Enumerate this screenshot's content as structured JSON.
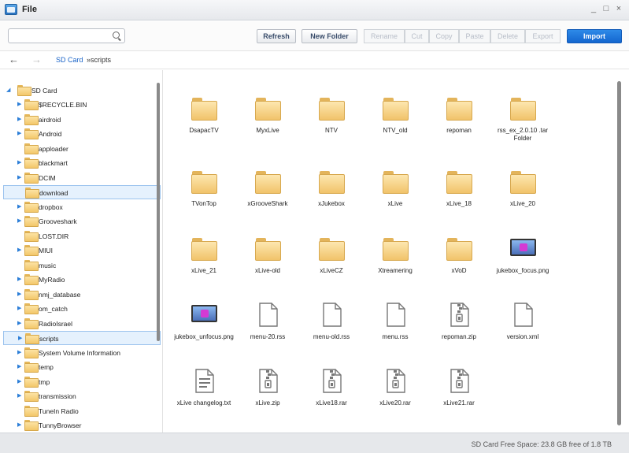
{
  "window": {
    "title": "File",
    "minimize": "_",
    "maximize": "□",
    "close": "×"
  },
  "search": {
    "value": "",
    "placeholder": ""
  },
  "toolbar": {
    "refresh": "Refresh",
    "new_folder": "New Folder",
    "rename": "Rename",
    "cut": "Cut",
    "copy": "Copy",
    "paste": "Paste",
    "delete": "Delete",
    "export": "Export",
    "import": "Import"
  },
  "nav": {
    "back": "←",
    "forward": "→",
    "crumb_root": "SD Card",
    "crumb_current": "»scripts"
  },
  "tree": {
    "root": "SD Card",
    "items": [
      {
        "label": "$RECYCLE.BIN",
        "expandable": true
      },
      {
        "label": "airdroid",
        "expandable": true
      },
      {
        "label": "Android",
        "expandable": true
      },
      {
        "label": "apploader",
        "expandable": false
      },
      {
        "label": "blackmart",
        "expandable": true
      },
      {
        "label": "DCIM",
        "expandable": true
      },
      {
        "label": "download",
        "expandable": false
      },
      {
        "label": "dropbox",
        "expandable": true
      },
      {
        "label": "Grooveshark",
        "expandable": true
      },
      {
        "label": "LOST.DIR",
        "expandable": false
      },
      {
        "label": "MIUI",
        "expandable": true
      },
      {
        "label": "music",
        "expandable": false
      },
      {
        "label": "MyRadio",
        "expandable": true
      },
      {
        "label": "nmj_database",
        "expandable": true
      },
      {
        "label": "om_catch",
        "expandable": true
      },
      {
        "label": "RadioIsrael",
        "expandable": true
      },
      {
        "label": "scripts",
        "expandable": true
      },
      {
        "label": "System Volume Information",
        "expandable": true
      },
      {
        "label": "temp",
        "expandable": true
      },
      {
        "label": "tmp",
        "expandable": true
      },
      {
        "label": "transmission",
        "expandable": true
      },
      {
        "label": "TuneIn Radio",
        "expandable": false
      },
      {
        "label": "TunnyBrowser",
        "expandable": true
      }
    ]
  },
  "files": [
    {
      "name": "DsapacTV",
      "type": "folder"
    },
    {
      "name": "MyxLive",
      "type": "folder"
    },
    {
      "name": "NTV",
      "type": "folder"
    },
    {
      "name": "NTV_old",
      "type": "folder"
    },
    {
      "name": "repoman",
      "type": "folder"
    },
    {
      "name": "rss_ex_2.0.10 .tar Folder",
      "type": "folder"
    },
    {
      "name": "TVonTop",
      "type": "folder"
    },
    {
      "name": "xGrooveShark",
      "type": "folder"
    },
    {
      "name": "xJukebox",
      "type": "folder"
    },
    {
      "name": "xLive",
      "type": "folder"
    },
    {
      "name": "xLive_18",
      "type": "folder"
    },
    {
      "name": "xLive_20",
      "type": "folder"
    },
    {
      "name": "xLive_21",
      "type": "folder"
    },
    {
      "name": "xLive-old",
      "type": "folder"
    },
    {
      "name": "xLiveCZ",
      "type": "folder"
    },
    {
      "name": "Xtreamering",
      "type": "folder"
    },
    {
      "name": "xVoD",
      "type": "folder"
    },
    {
      "name": "jukebox_focus.png",
      "type": "image"
    },
    {
      "name": "jukebox_unfocus.png",
      "type": "image"
    },
    {
      "name": "menu-20.rss",
      "type": "file"
    },
    {
      "name": "menu-old.rss",
      "type": "file"
    },
    {
      "name": "menu.rss",
      "type": "file"
    },
    {
      "name": "repoman.zip",
      "type": "zip"
    },
    {
      "name": "version.xml",
      "type": "file"
    },
    {
      "name": "xLive changelog.txt",
      "type": "text"
    },
    {
      "name": "xLive.zip",
      "type": "zip"
    },
    {
      "name": "xLive18.rar",
      "type": "zip"
    },
    {
      "name": "xLive20.rar",
      "type": "zip"
    },
    {
      "name": "xLive21.rar",
      "type": "zip"
    }
  ],
  "status": {
    "free_space": "SD Card Free Space: 23.8 GB free of 1.8 TB"
  }
}
